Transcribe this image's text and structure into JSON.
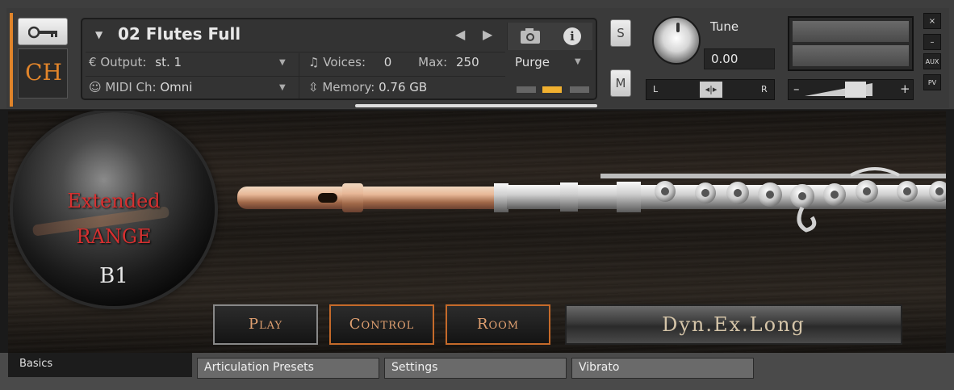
{
  "header": {
    "instrument_name": "02 Flutes Full",
    "output_label": "Output:",
    "output_value": "st. 1",
    "midi_label": "MIDI Ch:",
    "midi_value": "Omni",
    "voices_label": "Voices:",
    "voices_value": "0",
    "max_label": "Max:",
    "max_value": "250",
    "memory_label": "Memory:",
    "memory_value": "0.76 GB",
    "purge_label": "Purge",
    "info_label": "i",
    "ch_logo": "CH",
    "solo_label": "S",
    "mute_label": "M",
    "tune_label": "Tune",
    "tune_value": "0.00",
    "pan_left": "L",
    "pan_right": "R",
    "vol_minus": "–",
    "vol_plus": "+",
    "close_label": "×",
    "minimize_label": "–",
    "aux_label": "AUX",
    "pv_label": "PV"
  },
  "stage": {
    "orb_line1": "Extended",
    "orb_line2": "Range",
    "orb_note": "B1",
    "play_label": "Play",
    "control_label": "Control",
    "room_label": "Room",
    "articulation": "Dyn.Ex.Long"
  },
  "tabs": {
    "basics": "Basics",
    "items": [
      "Articulation Presets",
      "Settings",
      "Vibrato"
    ]
  },
  "colors": {
    "accent": "#e0842a",
    "purge_active": "#f0b030",
    "orb_text": "#d63030"
  }
}
